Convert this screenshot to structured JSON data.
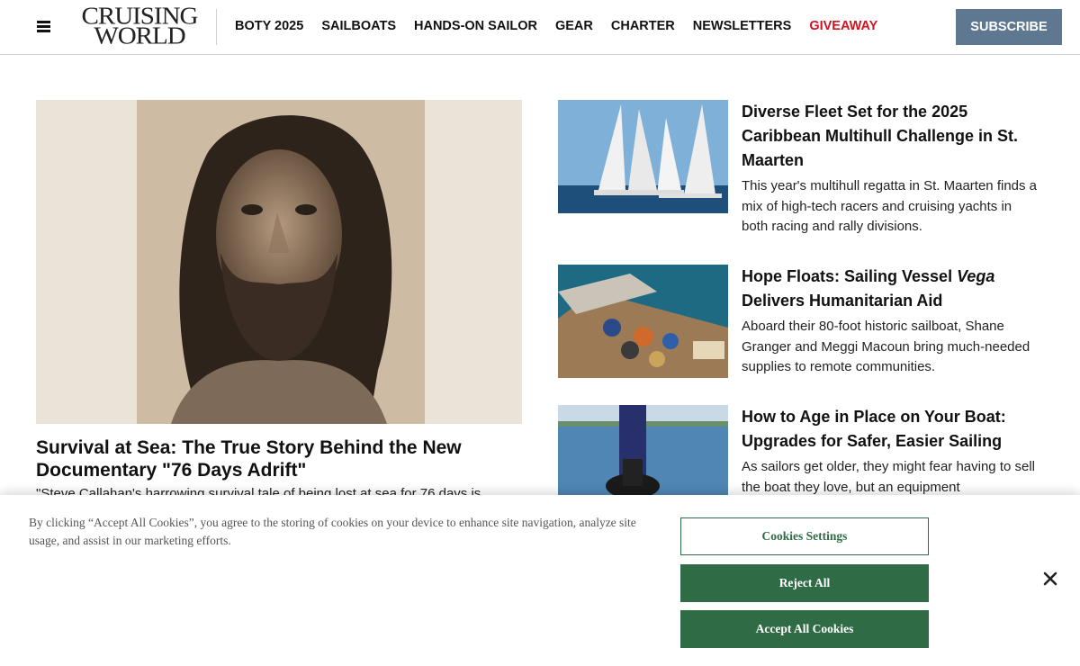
{
  "header": {
    "menu_icon": "hamburger-menu-icon",
    "logo_line1": "CRUISING",
    "logo_line2": "WORLD",
    "nav": [
      {
        "label": "BOTY 2025"
      },
      {
        "label": "SAILBOATS"
      },
      {
        "label": "HANDS-ON SAILOR"
      },
      {
        "label": "GEAR"
      },
      {
        "label": "CHARTER"
      },
      {
        "label": "NEWSLETTERS"
      },
      {
        "label": "GIVEAWAY"
      }
    ],
    "subscribe_label": "SUBSCRIBE",
    "accent_color": "#d3121f",
    "subscribe_color": "#5e7891"
  },
  "hero": {
    "image": "bearded-man-portrait-photo",
    "title": "Survival at Sea: The True Story Behind the New Documentary \"76 Days Adrift\"",
    "excerpt": "\"Steve Callahan's harrowing survival tale of being lost at sea for 76 days is"
  },
  "articles": [
    {
      "image": "racing-sailboats-photo",
      "title": "Diverse Fleet Set for the 2025 Caribbean Multihull Challenge in St. Maarten",
      "excerpt": "This year's multihull regatta in St. Maarten finds a mix of high-tech racers and cruising yachts in both racing and rally divisions."
    },
    {
      "image": "aerial-sailboat-deck-cargo-photo",
      "title_pre": "Hope Floats: Sailing Vessel ",
      "title_italic": "Vega",
      "title_post": " Delivers Humanitarian Aid",
      "excerpt": "Aboard their 80-foot historic sailboat, Shane Granger and Meggi Macoun bring much-needed supplies to remote communities."
    },
    {
      "image": "sailboat-winch-photo",
      "title": "How to Age in Place on Your Boat: Upgrades for Safer, Easier Sailing",
      "excerpt": "As sailors get older, they might fear having to sell the boat they love, but an equipment"
    }
  ],
  "cookie_banner": {
    "text": "By clicking “Accept All Cookies”, you agree to the storing of cookies on your device to enhance site navigation, analyze site usage, and assist in our marketing efforts.",
    "settings_label": "Cookies Settings",
    "reject_label": "Reject All",
    "accept_label": "Accept All Cookies",
    "close_icon": "close-icon",
    "button_color": "#2f6b45"
  }
}
